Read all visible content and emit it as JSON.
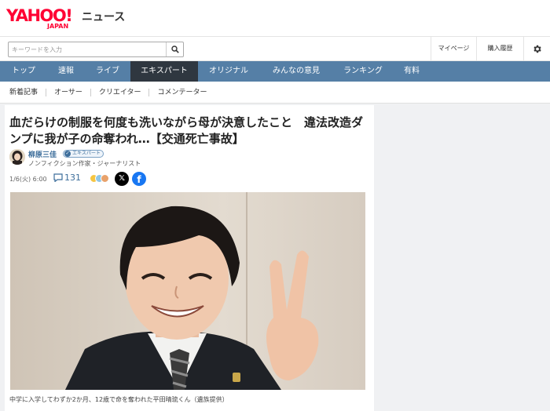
{
  "header": {
    "logo_text": "YAHOO!",
    "logo_sub": "JAPAN",
    "service_name": "ニュース"
  },
  "search": {
    "placeholder": "キーワードを入力",
    "value": ""
  },
  "top_links": {
    "mypage": "マイページ",
    "history": "購入履歴"
  },
  "nav": {
    "items": [
      {
        "label": "トップ"
      },
      {
        "label": "速報"
      },
      {
        "label": "ライブ"
      },
      {
        "label": "エキスパート"
      },
      {
        "label": "オリジナル"
      },
      {
        "label": "みんなの意見"
      },
      {
        "label": "ランキング"
      },
      {
        "label": "有料"
      }
    ],
    "active_index": 3,
    "color": "#557fa6",
    "active_color": "#2f3740"
  },
  "subnav": {
    "items": [
      {
        "label": "新着記事"
      },
      {
        "label": "オーサー"
      },
      {
        "label": "クリエイター"
      },
      {
        "label": "コメンテーター"
      }
    ]
  },
  "article": {
    "title": "血だらけの制服を何度も洗いながら母が決意したこと　違法改造ダンプに我が子の命奪われ…【交通死亡事故】",
    "author": {
      "name": "柳原三佳",
      "badge": "エキスパート",
      "role": "ノンフィクション作家・ジャーナリスト"
    },
    "date": "1/6(火) 6:00",
    "comment_count": "131",
    "photo_caption": "中学に入学してわずか2か月、12歳で命を奪われた平田晴琉くん（遺族提供）"
  }
}
